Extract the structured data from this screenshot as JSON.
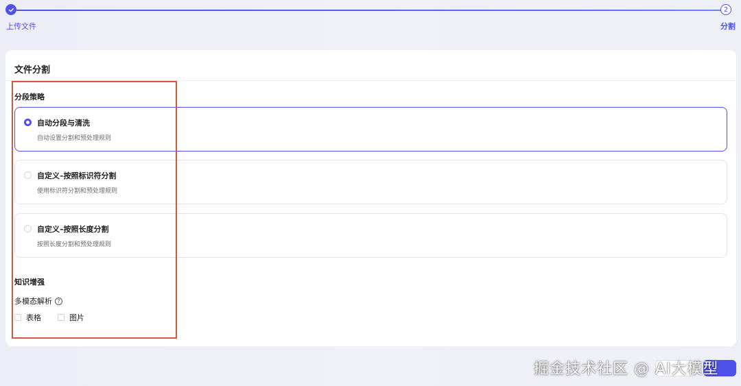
{
  "stepper": {
    "step1_label": "上传文件",
    "step2_number": "2",
    "step2_label": "分割"
  },
  "card": {
    "title": "文件分割",
    "strategy_title": "分段策略",
    "options": [
      {
        "title": "自动分段与清洗",
        "desc": "自动设置分割和预处理规则",
        "selected": true
      },
      {
        "title": "自定义–按照标识符分割",
        "desc": "使用标识符分割和预处理规则",
        "selected": false
      },
      {
        "title": "自定义–按照长度分割",
        "desc": "按照长度分割和预处理规则",
        "selected": false
      }
    ],
    "knowledge_title": "知识增强",
    "multimodal_label": "多模态解析",
    "checkboxes": [
      {
        "label": "表格",
        "checked": false
      },
      {
        "label": "图片",
        "checked": false
      }
    ]
  },
  "footer": {
    "watermark_text": "掘金技术社区 @ AI大模型"
  },
  "colors": {
    "accent": "#4d53e8",
    "annotation": "#d9553a"
  }
}
